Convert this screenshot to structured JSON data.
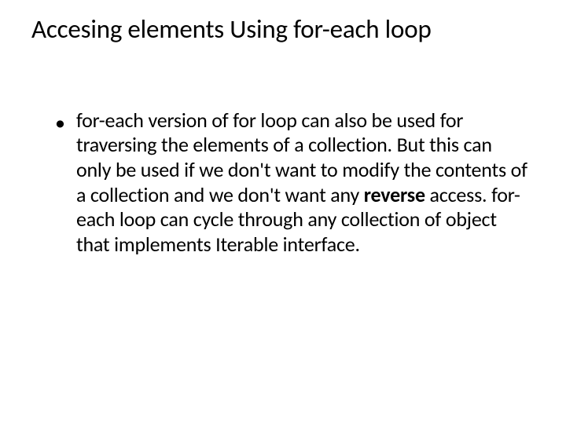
{
  "slide": {
    "title": "Accesing elements Using for-each loop",
    "bullet_marker": "•",
    "body_part1": "for-each version of for loop can also be used for traversing the elements of a collection. But this can only be used if we don't want to modify the contents of a collection and we don't want any ",
    "body_bold": "reverse",
    "body_part2": " access. for-each loop can cycle through any collection of object that implements Iterable interface."
  }
}
